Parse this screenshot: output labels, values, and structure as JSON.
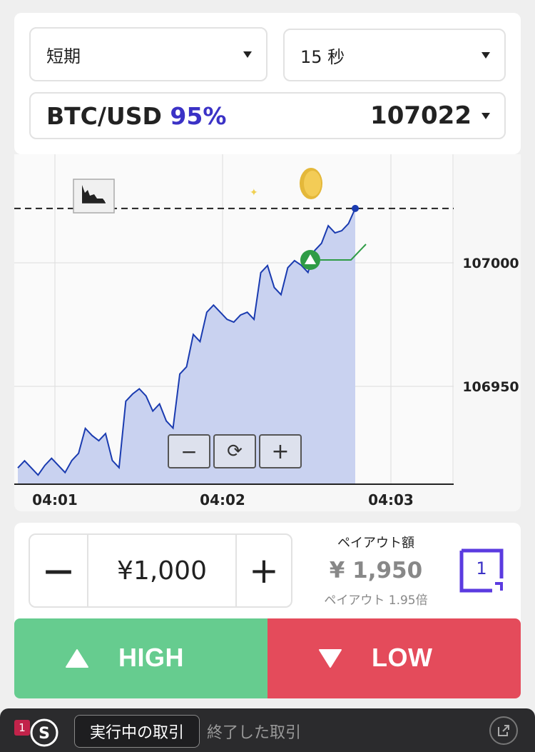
{
  "selectors": {
    "term": "短期",
    "duration": "15 秒"
  },
  "asset": {
    "pair": "BTC/USD",
    "payout_pct": "95%",
    "price": "107022"
  },
  "chart_data": {
    "type": "line",
    "x_ticks": [
      "04:01",
      "04:02",
      "04:03"
    ],
    "y_ticks": [
      "107000",
      "106950"
    ],
    "current_price": 107022,
    "series": [
      {
        "values": [
          106917,
          106917,
          106918,
          106918,
          106920,
          106933,
          106928,
          106920,
          106944,
          106949,
          106940,
          106936,
          106955,
          106971,
          106980,
          106980,
          106976,
          106980,
          106996,
          106990,
          106998,
          106999,
          107005,
          107015,
          107013,
          107022
        ]
      }
    ],
    "colors": {
      "line": "#1a3bb0",
      "fill": "#c9d2f0",
      "entry": "#2f9c46"
    }
  },
  "chart_controls": {
    "zoom_out": "−",
    "refresh": "⟳",
    "zoom_in": "+"
  },
  "trade": {
    "minus": "—",
    "amount": "¥1,000",
    "plus": "+",
    "payout_label": "ペイアウト額",
    "payout_value": "¥ 1,950",
    "payout_ratio": "ペイアウト 1.95倍",
    "one_click_count": "1"
  },
  "buttons": {
    "high": "HIGH",
    "low": "LOW"
  },
  "bottom": {
    "badge": "1",
    "active_tab": "実行中の取引",
    "closed_tab": "終了した取引"
  }
}
